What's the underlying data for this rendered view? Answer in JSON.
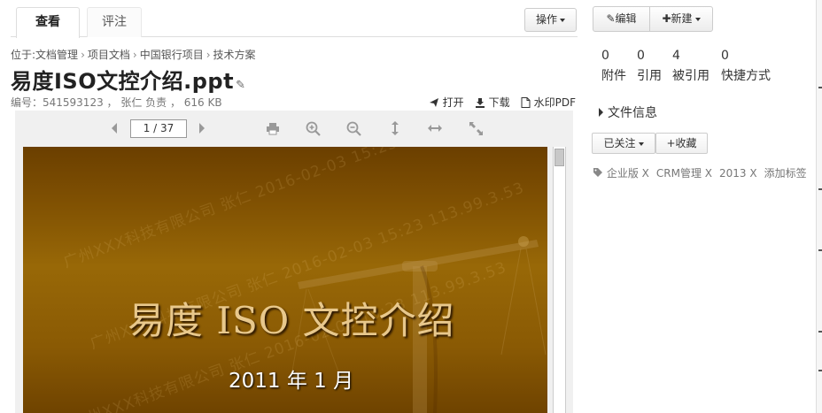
{
  "tabs": [
    {
      "label": "查看"
    },
    {
      "label": "评注"
    }
  ],
  "operations_button": "操作",
  "breadcrumb": {
    "prefix": "位于:",
    "items": [
      "文档管理",
      "项目文档",
      "中国银行项目",
      "技术方案"
    ]
  },
  "document": {
    "title": "易度ISO文控介绍.ppt",
    "meta": "编号：541593123 ， 张仁 负责 ， 616 KB"
  },
  "file_actions": {
    "open": "打开",
    "download": "下载",
    "watermark_pdf": "水印PDF"
  },
  "viewer": {
    "page_indicator": "1 / 37",
    "slide": {
      "title": "易度 ISO 文控介绍",
      "date": "2011 年 1 月",
      "watermark": "广州XXX科技有限公司 张仁 2016-02-03 15:23 113.99.3.53"
    }
  },
  "right_panel": {
    "edit_button": "编辑",
    "new_button": "新建",
    "stats": [
      {
        "count": "0",
        "label": "附件"
      },
      {
        "count": "0",
        "label": "引用"
      },
      {
        "count": "4",
        "label": "被引用"
      },
      {
        "count": "0",
        "label": "快捷方式"
      }
    ],
    "file_info": "文件信息",
    "follow_button": "已关注",
    "favorite_button": "+收藏",
    "tags": [
      "企业版 X",
      "CRM管理 X",
      "2013 X"
    ],
    "add_tag": "添加标签"
  }
}
